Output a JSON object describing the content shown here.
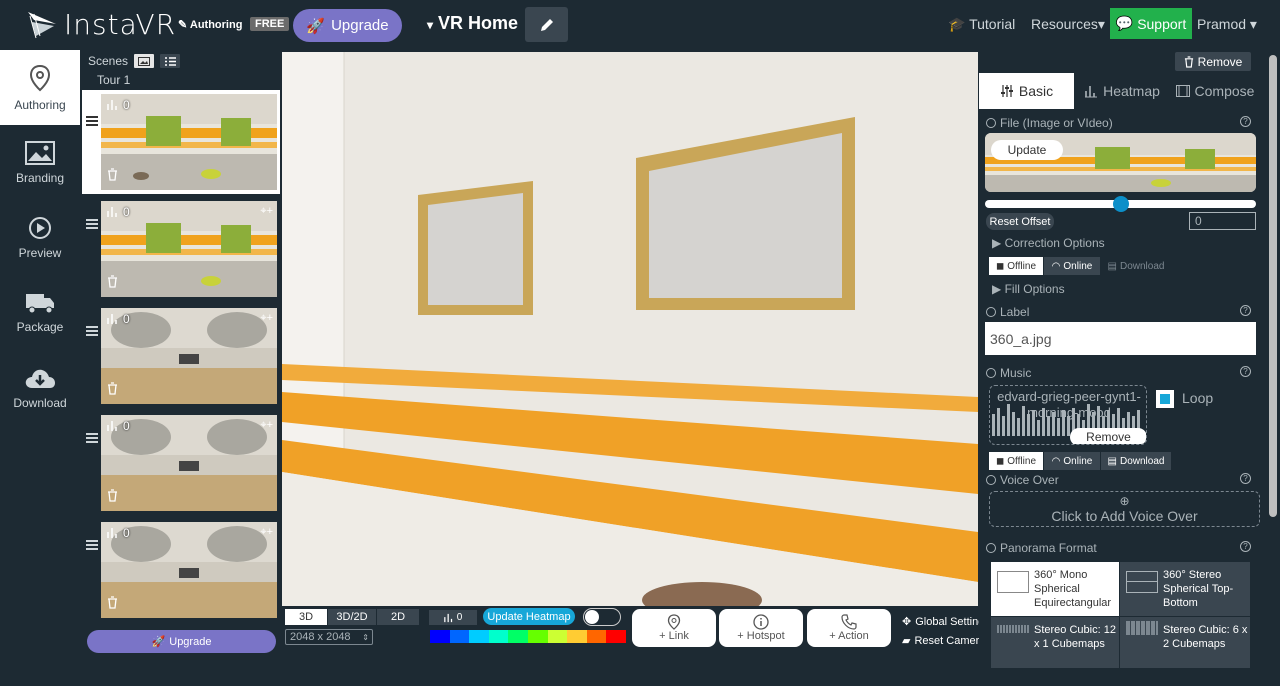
{
  "header": {
    "logo": "InstaVR",
    "authoring": "Authoring",
    "free": "FREE",
    "upgrade": "Upgrade",
    "project": "VR Home",
    "tutorial": "Tutorial",
    "resources": "Resources",
    "support": "Support",
    "user": "Pramod"
  },
  "leftnav": [
    {
      "label": "Authoring",
      "icon": "location-pin-icon",
      "active": true
    },
    {
      "label": "Branding",
      "icon": "image-icon"
    },
    {
      "label": "Preview",
      "icon": "play-icon"
    },
    {
      "label": "Package",
      "icon": "truck-icon"
    },
    {
      "label": "Download",
      "icon": "cloud-download-icon"
    }
  ],
  "scenes": {
    "title": "Scenes",
    "tour": "Tour 1",
    "items": [
      {
        "count": "0"
      },
      {
        "count": "0"
      },
      {
        "count": "0"
      },
      {
        "count": "0"
      },
      {
        "count": "0"
      }
    ],
    "upgrade": "Upgrade"
  },
  "viewer": {
    "mode_3d": "3D",
    "mode_3d2d": "3D/2D",
    "mode_2d": "2D",
    "resolution": "2048 x 2048",
    "heat_count": "0",
    "update_heatmap": "Update Heatmap",
    "add_link": "+ Link",
    "add_hotspot": "+ Hotspot",
    "add_action": "+ Action",
    "global_settings": "Global Settings",
    "reset_camera": "Reset Camera",
    "heat_colors": [
      "#0000ff",
      "#0066ff",
      "#00ccff",
      "#00ffcc",
      "#00ff66",
      "#66ff00",
      "#ccff33",
      "#ffcc33",
      "#ff6600",
      "#ff0000"
    ]
  },
  "panel": {
    "remove": "Remove",
    "tabs": {
      "basic": "Basic",
      "heatmap": "Heatmap",
      "compose": "Compose"
    },
    "file_label": "File (Image or VIdeo)",
    "update": "Update",
    "slider_value": 0.5,
    "reset_offset": "Reset Offset",
    "offset_value": "0",
    "correction": "Correction Options",
    "offline": "Offline",
    "online": "Online",
    "download": "Download",
    "fill": "Fill Options",
    "label_title": "Label",
    "label_value": "360_a.jpg",
    "music_title": "Music",
    "music_file": "edvard-grieg-peer-gynt1-morning-mood",
    "music_remove": "Remove",
    "loop": "Loop",
    "voice_title": "Voice Over",
    "voice_add": "Click to Add Voice Over",
    "pano_title": "Panorama Format",
    "pano": [
      {
        "label": "360° Mono Spherical Equirectangular",
        "active": true
      },
      {
        "label": "360° Stereo Spherical Top-Bottom"
      },
      {
        "label": "Stereo Cubic: 12 x 1 Cubemaps"
      },
      {
        "label": "Stereo Cubic: 6 x 2 Cubemaps"
      }
    ]
  }
}
